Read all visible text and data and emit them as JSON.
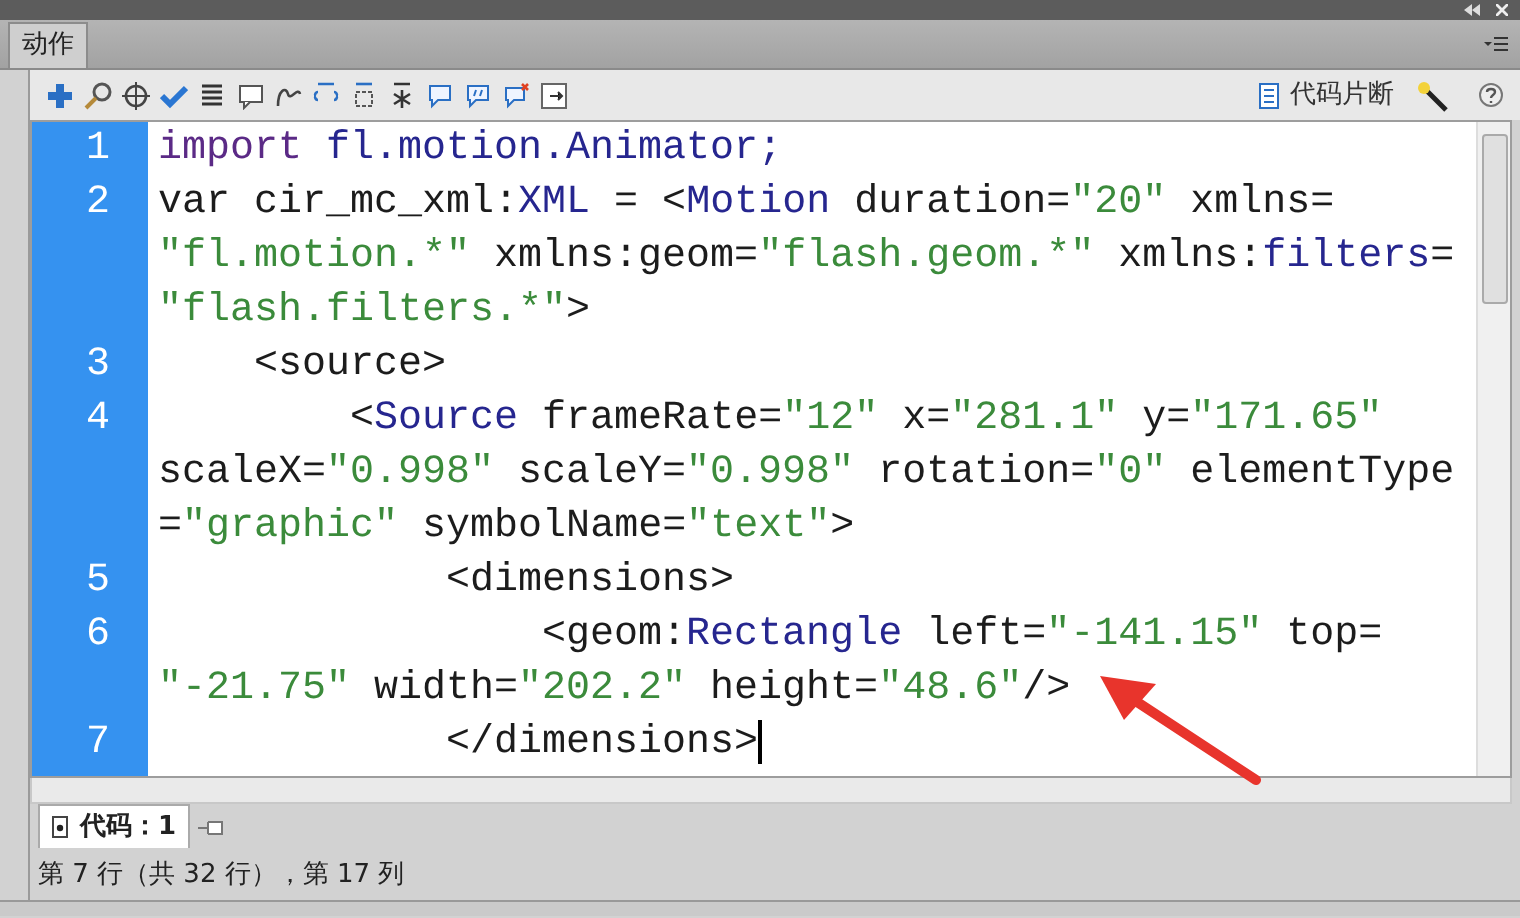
{
  "panel": {
    "tab": "动作"
  },
  "toolbar": {
    "snippets_label": "代码片断"
  },
  "editor": {
    "lines": [
      {
        "number": "1",
        "caret": false,
        "rows": [
          {
            "segments": [
              {
                "text": "import",
                "kind": "keyword"
              },
              {
                "text": " fl.motion.Animator;",
                "kind": "name"
              }
            ]
          }
        ]
      },
      {
        "number": "2",
        "caret": false,
        "rows": [
          {
            "segments": [
              {
                "text": "var cir_mc_xml:",
                "kind": "plain"
              },
              {
                "text": "XML",
                "kind": "name"
              },
              {
                "text": " = <",
                "kind": "plain"
              },
              {
                "text": "Motion",
                "kind": "name"
              },
              {
                "text": " duration=",
                "kind": "plain"
              },
              {
                "text": "\"20\"",
                "kind": "string"
              },
              {
                "text": " xmlns=",
                "kind": "plain"
              }
            ]
          },
          {
            "segments": [
              {
                "text": "\"fl.motion.*\"",
                "kind": "string"
              },
              {
                "text": " xmlns:geom=",
                "kind": "plain"
              },
              {
                "text": "\"flash.geom.*\"",
                "kind": "string"
              },
              {
                "text": " xmlns:",
                "kind": "plain"
              },
              {
                "text": "filters",
                "kind": "name"
              },
              {
                "text": "=",
                "kind": "plain"
              }
            ]
          },
          {
            "segments": [
              {
                "text": "\"flash.filters.*\"",
                "kind": "string"
              },
              {
                "text": ">",
                "kind": "plain"
              }
            ]
          }
        ]
      },
      {
        "number": "3",
        "caret": false,
        "rows": [
          {
            "segments": [
              {
                "text": "    <source>",
                "kind": "plain"
              }
            ]
          }
        ]
      },
      {
        "number": "4",
        "caret": false,
        "rows": [
          {
            "segments": [
              {
                "text": "        <",
                "kind": "plain"
              },
              {
                "text": "Source",
                "kind": "name"
              },
              {
                "text": " frameRate=",
                "kind": "plain"
              },
              {
                "text": "\"12\"",
                "kind": "string"
              },
              {
                "text": " x=",
                "kind": "plain"
              },
              {
                "text": "\"281.1\"",
                "kind": "string"
              },
              {
                "text": " y=",
                "kind": "plain"
              },
              {
                "text": "\"171.65\"",
                "kind": "string"
              }
            ]
          },
          {
            "segments": [
              {
                "text": "scaleX=",
                "kind": "plain"
              },
              {
                "text": "\"0.998\"",
                "kind": "string"
              },
              {
                "text": " scaleY=",
                "kind": "plain"
              },
              {
                "text": "\"0.998\"",
                "kind": "string"
              },
              {
                "text": " rotation=",
                "kind": "plain"
              },
              {
                "text": "\"0\"",
                "kind": "string"
              },
              {
                "text": " elementType",
                "kind": "plain"
              }
            ]
          },
          {
            "segments": [
              {
                "text": "=",
                "kind": "plain"
              },
              {
                "text": "\"graphic\"",
                "kind": "string"
              },
              {
                "text": " symbolName=",
                "kind": "plain"
              },
              {
                "text": "\"text\"",
                "kind": "string"
              },
              {
                "text": ">",
                "kind": "plain"
              }
            ]
          }
        ]
      },
      {
        "number": "5",
        "caret": false,
        "rows": [
          {
            "segments": [
              {
                "text": "            <dimensions>",
                "kind": "plain"
              }
            ]
          }
        ]
      },
      {
        "number": "6",
        "caret": false,
        "rows": [
          {
            "segments": [
              {
                "text": "                <geom:",
                "kind": "plain"
              },
              {
                "text": "Rectangle",
                "kind": "name"
              },
              {
                "text": " left=",
                "kind": "plain"
              },
              {
                "text": "\"-141.15\"",
                "kind": "string"
              },
              {
                "text": " top=",
                "kind": "plain"
              }
            ]
          },
          {
            "segments": [
              {
                "text": "\"-21.75\"",
                "kind": "string"
              },
              {
                "text": " width=",
                "kind": "plain"
              },
              {
                "text": "\"202.2\"",
                "kind": "string"
              },
              {
                "text": " height=",
                "kind": "plain"
              },
              {
                "text": "\"48.6\"",
                "kind": "string"
              },
              {
                "text": "/>",
                "kind": "plain"
              }
            ]
          }
        ]
      },
      {
        "number": "7",
        "caret": true,
        "rows": [
          {
            "segments": [
              {
                "text": "            </dimensions>",
                "kind": "plain"
              }
            ]
          }
        ]
      }
    ]
  },
  "script_tabs": [
    {
      "label": "代码：1",
      "selected": true
    }
  ],
  "status_bar": "第 7 行（共 32 行），第 17 列"
}
